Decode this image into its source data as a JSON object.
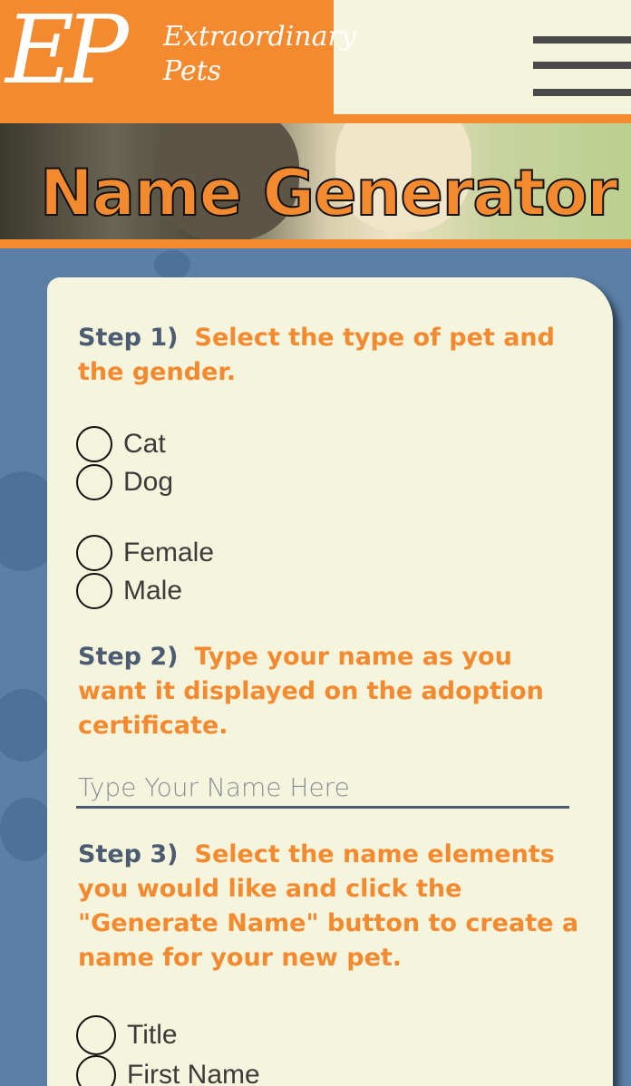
{
  "header": {
    "logo_mark": "EP",
    "logo_line1": "Extraordinary",
    "logo_line2": "Pets",
    "menu_icon": "hamburger-menu-icon"
  },
  "banner": {
    "title": "Name Generator"
  },
  "step1": {
    "number": "Step 1)",
    "text": "Select the type of pet and the gender.",
    "pet_options": [
      "Cat",
      "Dog"
    ],
    "gender_options": [
      "Female",
      "Male"
    ]
  },
  "step2": {
    "number": "Step 2)",
    "text": "Type your name as you want it displayed on the adoption certificate.",
    "input_placeholder": "Type Your Name Here",
    "input_value": ""
  },
  "step3": {
    "number": "Step 3)",
    "text": "Select the name elements you would like and click the \"Generate Name\" button to create a name for your new pet.",
    "options": [
      "Title",
      "First Name"
    ]
  },
  "colors": {
    "accent": "#f38a30",
    "background": "#5b7fa6",
    "panel": "#f5f4dc",
    "step_label": "#4b5b72"
  }
}
